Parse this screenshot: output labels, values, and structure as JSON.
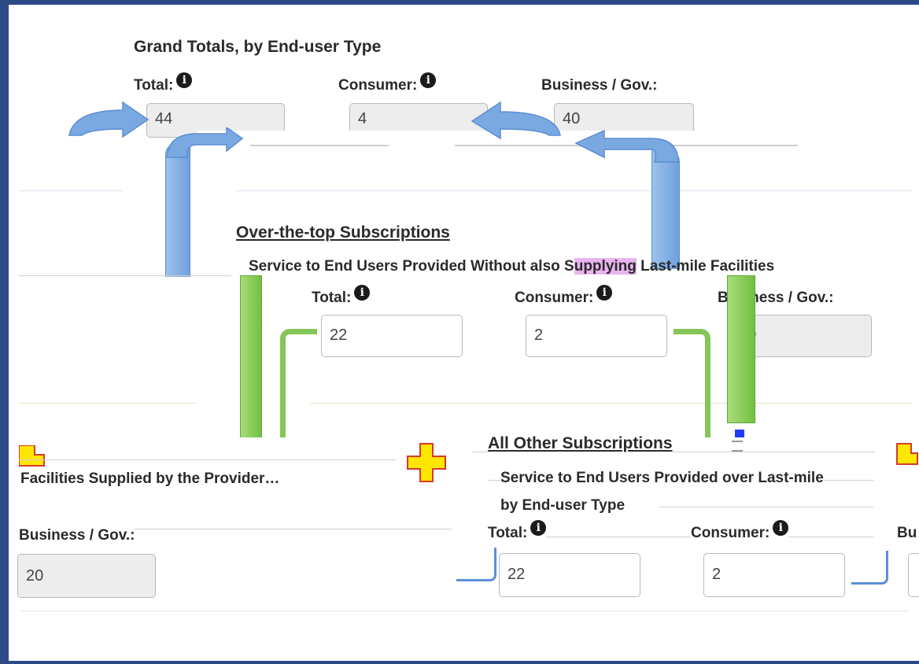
{
  "grand": {
    "title": "Grand Totals, by End-user Type",
    "total_label": "Total:",
    "consumer_label": "Consumer:",
    "business_label": "Business / Gov.:",
    "total_value": "44",
    "consumer_value": "4",
    "business_value": "40"
  },
  "ott": {
    "title": "Over-the-top Subscriptions",
    "subtitle_pre": "Service to End Users Provided Without also S",
    "subtitle_hl": "upplying",
    "subtitle_post": " Last-mile Facilities",
    "total_label": "Total:",
    "consumer_label": "Consumer:",
    "business_label": "Business / Gov.:",
    "total_value": "22",
    "consumer_value": "2",
    "business_value": "20"
  },
  "left": {
    "subtitle": "Facilities Supplied by the Provider…",
    "business_label": "Business / Gov.:",
    "business_value": "20"
  },
  "other": {
    "title": "All Other Subscriptions",
    "subtitle_line1": "Service to End Users Provided over Last-mile",
    "subtitle_line2": "by End-user Type",
    "total_label": "Total:",
    "consumer_label": "Consumer:",
    "business_label": "Bu",
    "total_value": "22",
    "consumer_value": "2"
  },
  "colors": {
    "frame": "#2b4a86",
    "blue_arrow": "#7aa9e2",
    "green_arrow": "#7cc34b",
    "plus_marker": "#ffe600",
    "highlight": "#e9b4f0"
  },
  "icons": [
    "info-icon",
    "arrow-icon",
    "plus-marker-icon"
  ]
}
